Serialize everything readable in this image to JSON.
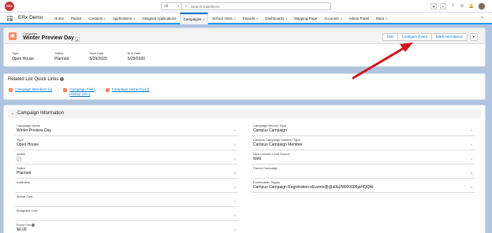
{
  "header": {
    "logo_text": "ERx",
    "search_scope": "All",
    "search_placeholder": "Search Salesforce"
  },
  "nav": {
    "app_name": "ERx Demo",
    "items": [
      {
        "label": "Home",
        "dropdown": false,
        "active": false
      },
      {
        "label": "Pardot",
        "dropdown": false,
        "active": false
      },
      {
        "label": "Contacts",
        "dropdown": true,
        "active": false
      },
      {
        "label": "Applications",
        "dropdown": true,
        "active": false
      },
      {
        "label": "Assigned Applications",
        "dropdown": false,
        "active": false
      },
      {
        "label": "Campaigns",
        "dropdown": true,
        "active": true
      },
      {
        "label": "School Visits",
        "dropdown": true,
        "active": false
      },
      {
        "label": "Reports",
        "dropdown": true,
        "active": false
      },
      {
        "label": "Dashboards",
        "dropdown": true,
        "active": false
      },
      {
        "label": "Mapping Page",
        "dropdown": false,
        "active": false
      },
      {
        "label": "Accounts",
        "dropdown": true,
        "active": false
      },
      {
        "label": "Admin Panel",
        "dropdown": false,
        "active": false
      },
      {
        "label": "More",
        "dropdown": true,
        "active": false
      }
    ]
  },
  "record": {
    "object_type": "Campaign",
    "name": "Winter Preview Day",
    "follow_mark": "A",
    "actions": {
      "edit": "Edit",
      "configure_event": "Configure Event",
      "mark_attendance": "Mark Attendance"
    },
    "highlight_fields": {
      "type": {
        "label": "Type",
        "value": "Open House"
      },
      "status": {
        "label": "Status",
        "value": "Planned"
      },
      "start_date": {
        "label": "Start Date",
        "value": "5/29/2020"
      },
      "end_date": {
        "label": "End Date",
        "value": "5/29/2020"
      }
    }
  },
  "quick_links": {
    "title": "Related List Quick Links",
    "links": {
      "members": "Campaign Members (1)",
      "field_history_1": "Campaign Field",
      "field_history_2": "History (10+)",
      "hierarchy": "Campaign Hierarchy (0)"
    }
  },
  "details": {
    "section_title": "Campaign Information",
    "left": {
      "campaign_name": {
        "label": "Campaign Name",
        "value": "Winter Preview Day"
      },
      "type": {
        "label": "Type",
        "value": "Open House"
      },
      "active": {
        "label": "Active",
        "value": "✓"
      },
      "status": {
        "label": "Status",
        "value": "Planned"
      },
      "institution": {
        "label": "Institution",
        "value": ""
      },
      "actual_cost": {
        "label": "Actual Cost",
        "value": ""
      },
      "budgeted_cost": {
        "label": "Budgeted Cost",
        "value": ""
      },
      "event_fee": {
        "label": "Event Fee",
        "value": "$0.00"
      }
    },
    "right": {
      "record_type": {
        "label": "Campaign Record Type",
        "value": "Campus Campaign"
      },
      "member_type": {
        "label": "Campus Campaign Member Type",
        "value": "Campus Campaign Member"
      },
      "lead_source": {
        "label": "New Contact Lead Source",
        "value": "Web"
      },
      "parent": {
        "label": "Parent Campaign",
        "value": ""
      },
      "formbuilder": {
        "label": "Formbuilder Pages",
        "value": "Campus Campaign Registration:eEvents@@a0b2M000005jpHQQAI"
      }
    }
  },
  "colors": {
    "accent": "#0176d3",
    "object_icon": "#f88962",
    "annotation_arrow": "#d0151a",
    "background": "#b0c4df"
  }
}
